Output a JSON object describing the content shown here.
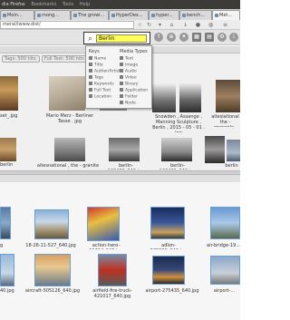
{
  "window": {
    "title": "dia Firefox",
    "menus": [
      "Bookmarks",
      "Tools",
      "Help"
    ]
  },
  "tabs": [
    {
      "label": "Moin..."
    },
    {
      "label": "mong..."
    },
    {
      "label": "The growi..."
    },
    {
      "label": "HyperDex..."
    },
    {
      "label": "hyper..."
    },
    {
      "label": "bench..."
    },
    {
      "label": "Met..."
    }
  ],
  "navbar": {
    "url": "meral/lwww.dist/"
  },
  "search": {
    "value": "Berlin"
  },
  "dropdown": {
    "keys_heading": "Keys",
    "media_heading": "Media Types",
    "keys": [
      "Name",
      "Title",
      "Author/Artist",
      "Tags",
      "Keywords",
      "Full Text",
      "Location"
    ],
    "media": [
      "Text",
      "Image",
      "Audio",
      "Video",
      "Binary",
      "Application",
      "Folder",
      "Node"
    ]
  },
  "filters": {
    "chip1": "Tags: 500 hits",
    "chip2": "Full Text: 500 hits"
  },
  "top_results": {
    "row1": [
      {
        "caption": "set_.jpg"
      },
      {
        "caption": "Mario Merz - Berliner Tasse . jpg"
      },
      {
        "caption": ""
      },
      {
        "caption": "Snowden , Assange , Manning Sculpture , Berlin , 2015 - 05 - 01 . jpg"
      },
      {
        "caption": ""
      },
      {
        "caption": "alteslational the - operaple . jpg"
      }
    ],
    "row2": [
      {
        "caption": "berlin"
      },
      {
        "caption": "altesnational , the - granite - . jpg"
      },
      {
        "caption": "berlin-102486_640.jpg"
      },
      {
        "caption": "berlin-102489_640.jpg"
      },
      {
        "caption": ""
      },
      {
        "caption": "berlin"
      }
    ]
  },
  "bottom_results": {
    "row1": [
      {
        "caption": "g"
      },
      {
        "caption": "18-26-11-527_640.jpg"
      },
      {
        "caption": "action-hero-11214_640.jpg"
      },
      {
        "caption": "adlon-505900_640.jpg"
      },
      {
        "caption": "air-bridge-19..."
      }
    ],
    "row2": [
      {
        "caption": "40.jpg"
      },
      {
        "caption": "aircraft-505126_640.jpg"
      },
      {
        "caption": "airfield-fire-truck-421017_640.jpg"
      },
      {
        "caption": "airport-275435_640.jpg"
      },
      {
        "caption": "airport-..."
      }
    ]
  }
}
